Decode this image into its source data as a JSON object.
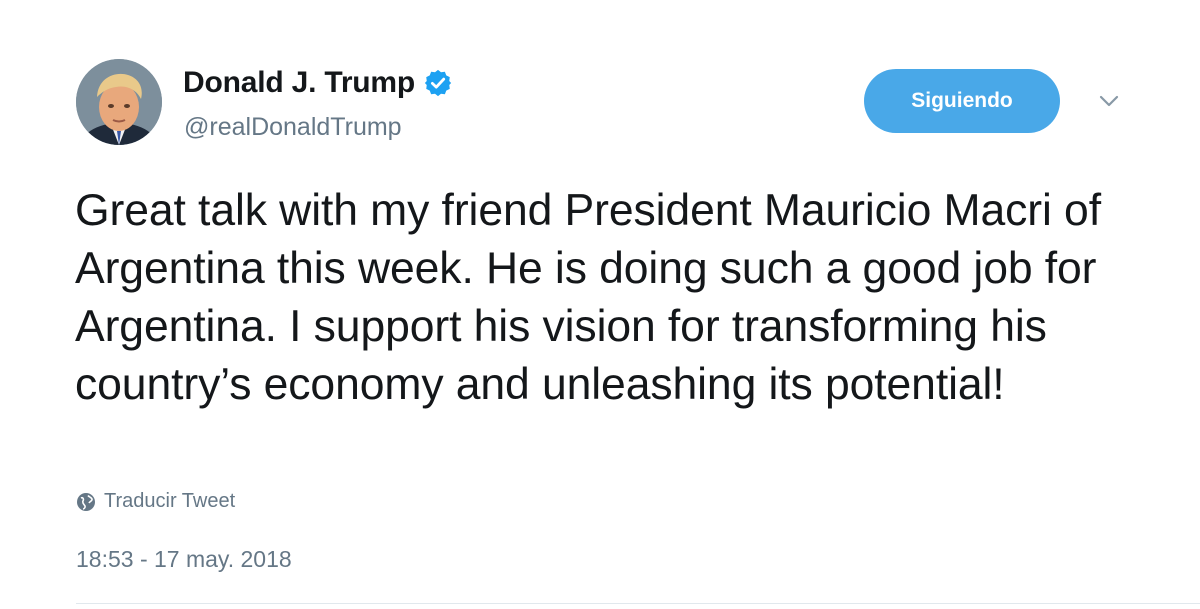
{
  "user": {
    "display_name": "Donald J. Trump",
    "handle": "@realDonaldTrump",
    "verified_icon": "verified-badge-icon",
    "avatar_icon": "profile-photo"
  },
  "actions": {
    "follow_label": "Siguiendo",
    "more_icon": "chevron-down-icon"
  },
  "tweet": {
    "text": "Great talk with my friend President Mauricio Macri of Argentina this week. He is doing such a good job for Argentina. I support his vision for transforming his country’s economy and unleashing its potential!",
    "translate_label": "Traducir Tweet",
    "translate_icon": "globe-icon",
    "timestamp": "18:53 - 17 may. 2018"
  },
  "colors": {
    "accent": "#49a8e8",
    "verified": "#1da1f2",
    "muted_text": "#657786",
    "primary_text": "#14171a"
  }
}
